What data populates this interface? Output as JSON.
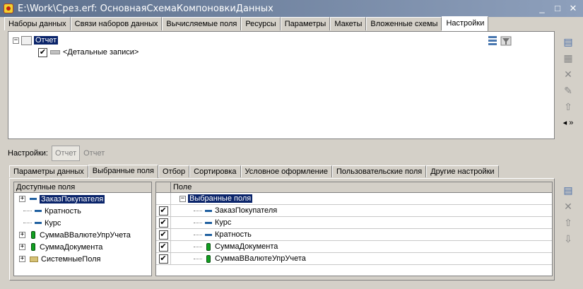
{
  "window": {
    "title": "E:\\Work\\Срез.erf: ОсновнаяСхемаКомпоновкиДанных",
    "minimize": "_",
    "maximize": "□",
    "close": "✕"
  },
  "top_tabs": [
    {
      "label": "Наборы данных"
    },
    {
      "label": "Связи наборов данных"
    },
    {
      "label": "Вычисляемые поля"
    },
    {
      "label": "Ресурсы"
    },
    {
      "label": "Параметры"
    },
    {
      "label": "Макеты"
    },
    {
      "label": "Вложенные схемы"
    },
    {
      "label": "Настройки",
      "active": true
    }
  ],
  "structure_tree": {
    "root_label": "Отчет",
    "child_label": "<Детальные записи>",
    "child_checked": "✔"
  },
  "settings": {
    "label": "Настройки:",
    "button1": "Отчет",
    "button2": "Отчет"
  },
  "sub_tabs": [
    {
      "label": "Параметры данных"
    },
    {
      "label": "Выбранные поля",
      "active": true
    },
    {
      "label": "Отбор"
    },
    {
      "label": "Сортировка"
    },
    {
      "label": "Условное оформление"
    },
    {
      "label": "Пользовательские поля"
    },
    {
      "label": "Другие настройки"
    }
  ],
  "available_fields": {
    "header": "Доступные поля",
    "items": [
      {
        "label": "ЗаказПокупателя",
        "expand": "+",
        "icon": "dash-icon",
        "selected": true
      },
      {
        "label": "Кратность",
        "expand": "",
        "icon": "dash-icon"
      },
      {
        "label": "Курс",
        "expand": "",
        "icon": "dash-icon"
      },
      {
        "label": "СуммаВВалютеУпрУчета",
        "expand": "+",
        "icon": "resource-icon"
      },
      {
        "label": "СуммаДокумента",
        "expand": "+",
        "icon": "resource-icon"
      },
      {
        "label": "СистемныеПоля",
        "expand": "+",
        "icon": "folder-icon"
      }
    ]
  },
  "selected_fields": {
    "header": "Поле",
    "root_label": "Выбранные поля",
    "root_expand": "−",
    "items": [
      {
        "label": "ЗаказПокупателя",
        "check": "✔",
        "icon": "dash-icon"
      },
      {
        "label": "Курс",
        "check": "✔",
        "icon": "dash-icon"
      },
      {
        "label": "Кратность",
        "check": "✔",
        "icon": "dash-icon"
      },
      {
        "label": "СуммаДокумента",
        "check": "✔",
        "icon": "resource-icon"
      },
      {
        "label": "СуммаВВалютеУпрУчета",
        "check": "✔",
        "icon": "resource-icon"
      }
    ]
  },
  "colors": {
    "selection": "#0a246a",
    "titlebar_start": "#5c6f8c",
    "titlebar_end": "#8ea0bc",
    "panel_bg": "#d4d0c8"
  }
}
